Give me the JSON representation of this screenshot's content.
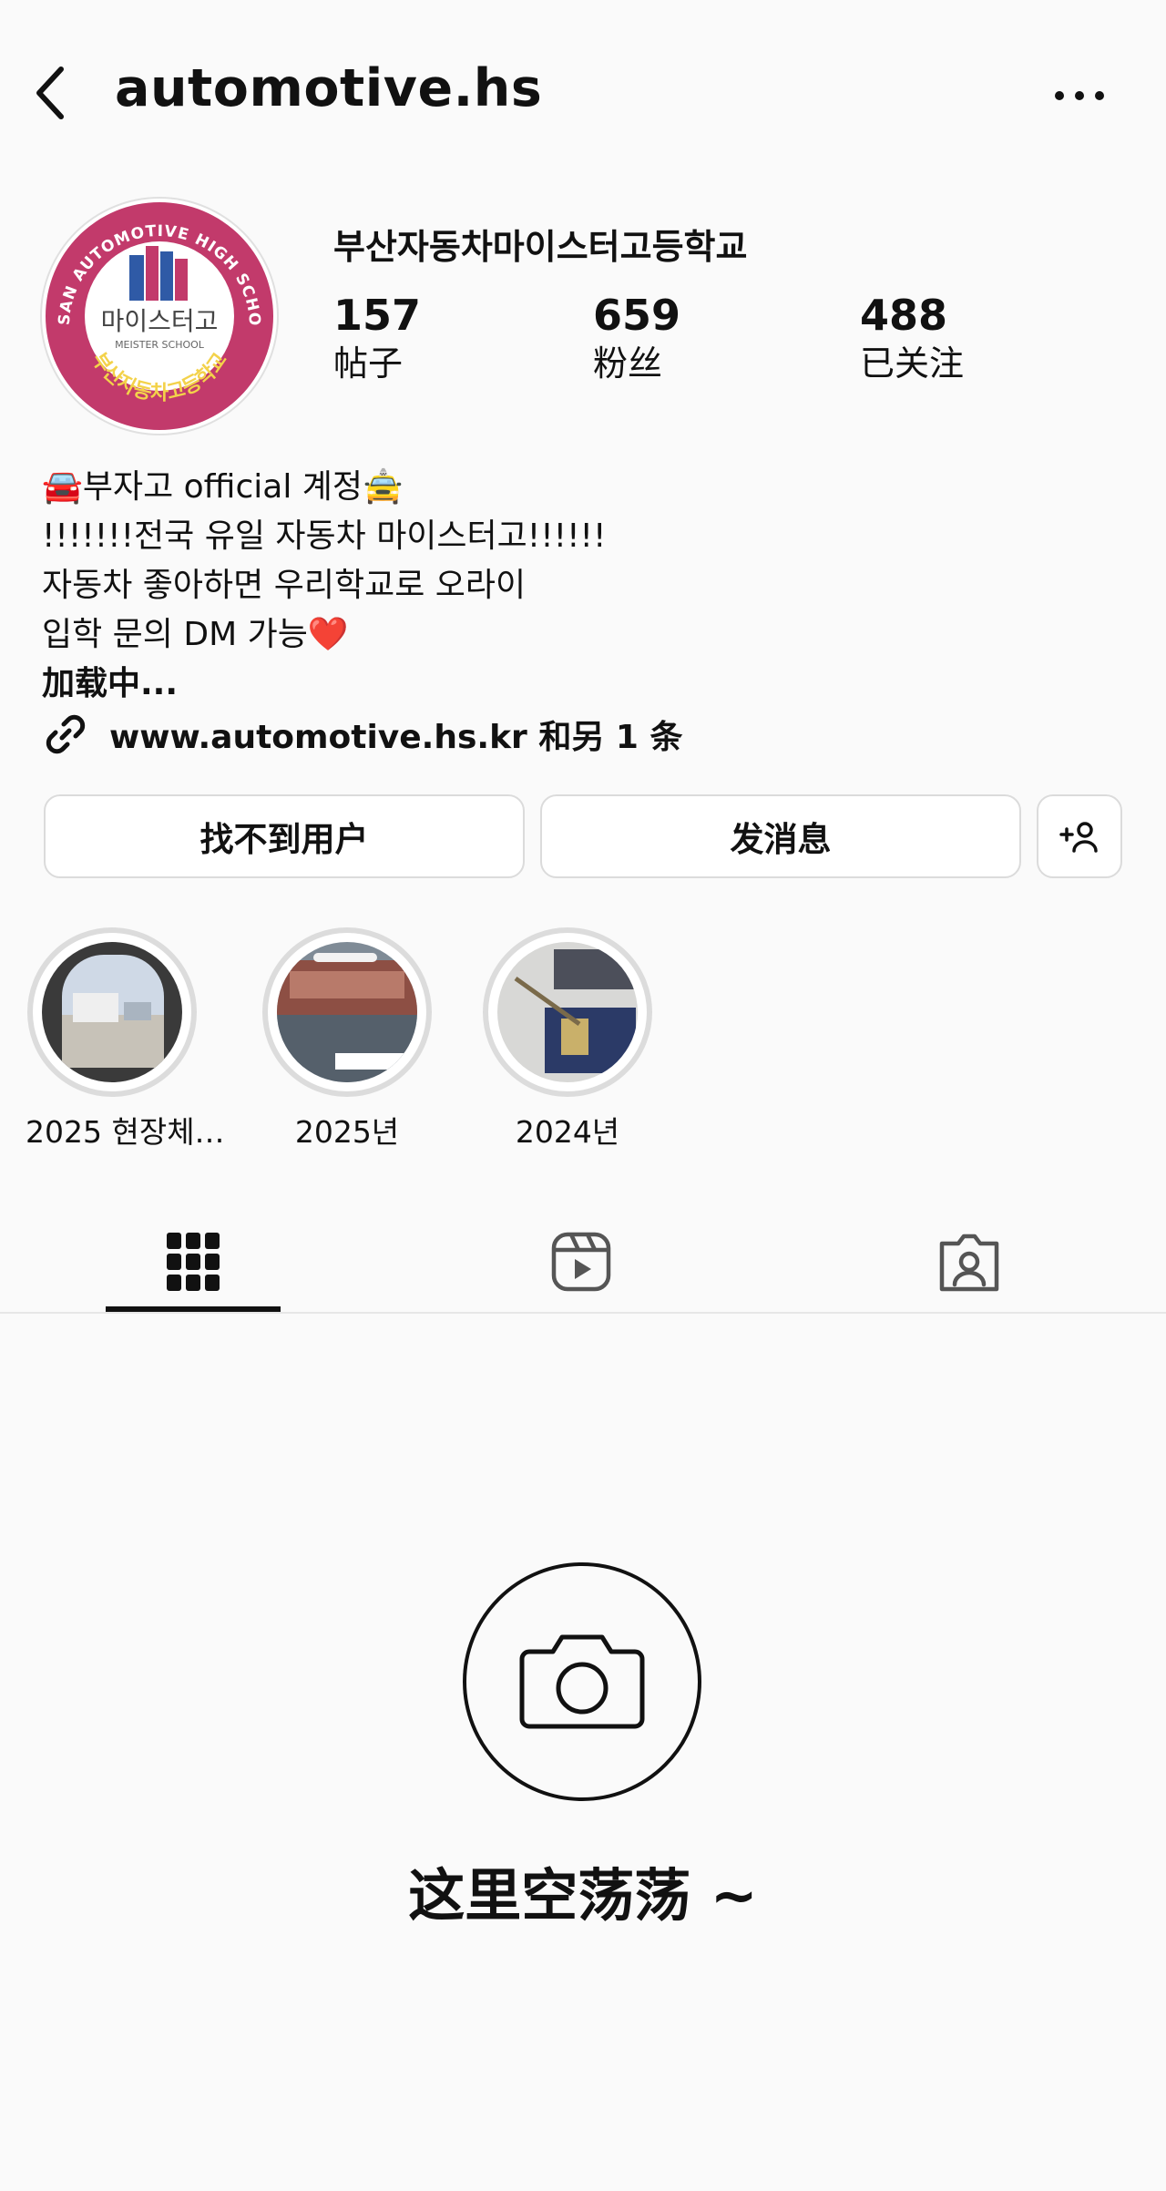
{
  "header": {
    "title": "automotive.hs",
    "back_icon": "chevron-left-icon",
    "more_icon": "more-horizontal-icon"
  },
  "profile": {
    "avatar_logo": {
      "ring_text": "BUSAN AUTOMOTIVE HIGH SCHOOL",
      "center_text": "마이스터고",
      "sub_text": "MEISTER SCHOOL",
      "bottom_text": "부산자동차고등학교"
    },
    "display_name": "부산자동차마이스터고등학교",
    "stats": [
      {
        "value": "157",
        "label": "帖子"
      },
      {
        "value": "659",
        "label": "粉丝"
      },
      {
        "value": "488",
        "label": "已关注"
      }
    ],
    "bio": [
      "🚘부자고 official 계정🚖",
      "!!!!!!!전국 유일 자동차 마이스터고!!!!!!",
      "자동차 좋아하면 우리학교로 오라이",
      "입학 문의 DM 가능❤️"
    ],
    "loading_text": "加载中...",
    "link_text": "www.automotive.hs.kr 和另 1 条"
  },
  "actions": {
    "primary_label": "找不到用户",
    "message_label": "发消息",
    "add_user_icon": "add-person-icon"
  },
  "highlights": [
    {
      "label": "2025 현장체…"
    },
    {
      "label": "2025년"
    },
    {
      "label": "2024년"
    }
  ],
  "tabs": {
    "active": "grid",
    "items": [
      "grid-icon",
      "reels-icon",
      "tagged-icon"
    ]
  },
  "empty_state": {
    "icon": "camera-icon",
    "text": "这里空荡荡 ~"
  },
  "colors": {
    "logo_magenta": "#c23a6b",
    "background": "#fafafa"
  }
}
